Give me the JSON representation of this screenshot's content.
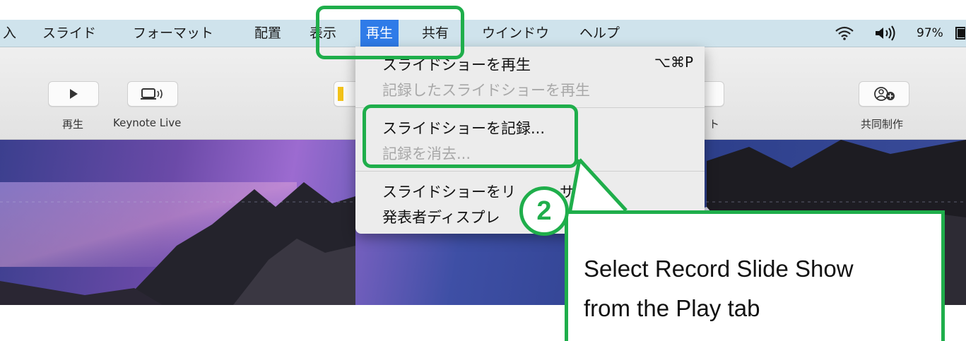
{
  "menubar": {
    "items": [
      "入",
      "スライド",
      "フォーマット",
      "配置",
      "表示",
      "再生",
      "共有",
      "ウインドウ",
      "ヘルプ"
    ],
    "active_item": "再生",
    "battery": "97%",
    "icons": [
      "wifi-icon",
      "volume-icon",
      "battery-icon"
    ]
  },
  "toolbar": {
    "play_label": "再生",
    "keynote_live_label": "Keynote Live",
    "collaborate_label": "共同制作",
    "partial_label": "ト"
  },
  "dropdown": {
    "items": [
      {
        "label": "スライドショーを再生",
        "shortcut": "⌥⌘P",
        "enabled": true
      },
      {
        "label": "記録したスライドショーを再生",
        "enabled": false
      },
      {
        "label": "スライドショーを記録...",
        "enabled": true
      },
      {
        "label": "記録を消去...",
        "enabled": false
      },
      {
        "label": "スライドショーをリハーサル",
        "visible_text": "スライドショーをリ",
        "tail_text": "サル",
        "enabled": true
      },
      {
        "label": "発表者ディスプレイ",
        "visible_text": "発表者ディスプレ",
        "enabled": true
      }
    ]
  },
  "annotation": {
    "step_number": "2",
    "callout_line1": "Select Record Slide Show",
    "callout_line2": "from the Play tab",
    "accent_color": "#1fae4b"
  }
}
